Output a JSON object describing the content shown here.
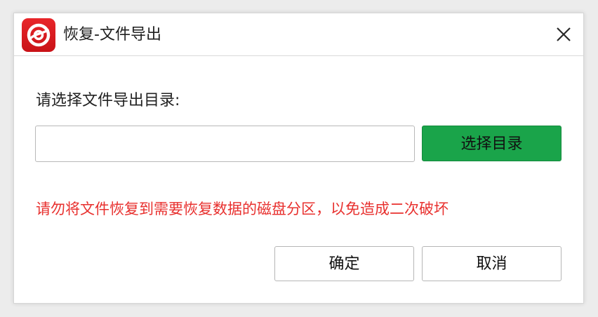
{
  "window": {
    "title": "恢复-文件导出",
    "app_icon": "recovery-logo-icon",
    "close_icon": "close-icon"
  },
  "form": {
    "prompt_label": "请选择文件导出目录:",
    "directory_input": {
      "value": "",
      "placeholder": ""
    },
    "select_dir_label": "选择目录"
  },
  "warning": {
    "text": "请勿将文件恢复到需要恢复数据的磁盘分区，以免造成二次破坏"
  },
  "actions": {
    "ok_label": "确定",
    "cancel_label": "取消"
  },
  "colors": {
    "brand_red": "#d81b1f",
    "accent_green": "#1aa44a",
    "warning_red": "#e8302e"
  }
}
